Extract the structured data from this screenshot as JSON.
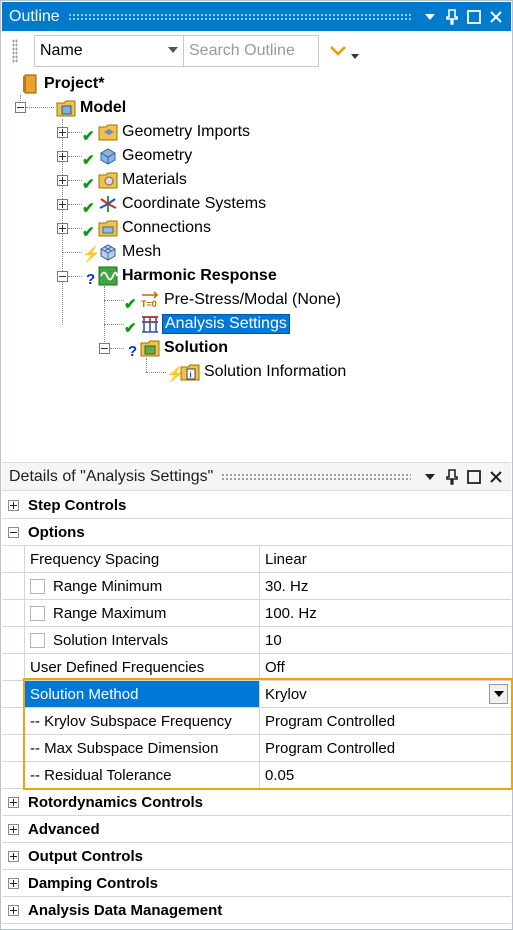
{
  "outline": {
    "title": "Outline",
    "toolbar": {
      "name_combo": "Name",
      "search_placeholder": "Search Outline"
    },
    "tree": {
      "project": "Project*",
      "model": "Model",
      "geometry_imports": "Geometry Imports",
      "geometry": "Geometry",
      "materials": "Materials",
      "coordinate_systems": "Coordinate Systems",
      "connections": "Connections",
      "mesh": "Mesh",
      "harmonic_response": "Harmonic Response",
      "prestress": "Pre-Stress/Modal (None)",
      "analysis_settings": "Analysis Settings",
      "solution": "Solution",
      "solution_information": "Solution Information"
    }
  },
  "details": {
    "title": "Details of \"Analysis Settings\"",
    "categories": {
      "step_controls": "Step Controls",
      "options": "Options",
      "rotordynamics": "Rotordynamics Controls",
      "advanced": "Advanced",
      "output_controls": "Output Controls",
      "damping_controls": "Damping Controls",
      "analysis_data": "Analysis Data Management"
    },
    "rows": [
      {
        "name": "Frequency Spacing",
        "value": "Linear"
      },
      {
        "name": "Range Minimum",
        "value": "30. Hz"
      },
      {
        "name": "Range Maximum",
        "value": "100. Hz"
      },
      {
        "name": "Solution Intervals",
        "value": "10"
      },
      {
        "name": "User Defined Frequencies",
        "value": "Off"
      },
      {
        "name": "Solution Method",
        "value": "Krylov"
      },
      {
        "name": "-- Krylov Subspace Frequency",
        "value": "Program Controlled"
      },
      {
        "name": "-- Max Subspace Dimension",
        "value": "Program Controlled"
      },
      {
        "name": "-- Residual Tolerance",
        "value": "0.05"
      }
    ]
  },
  "colors": {
    "active_title": "#007acc",
    "selection": "#0078d7",
    "highlight_border": "#f0a30a",
    "check_green": "#119911",
    "question_blue": "#0033cc",
    "bolt_yellow": "#e0b000"
  }
}
